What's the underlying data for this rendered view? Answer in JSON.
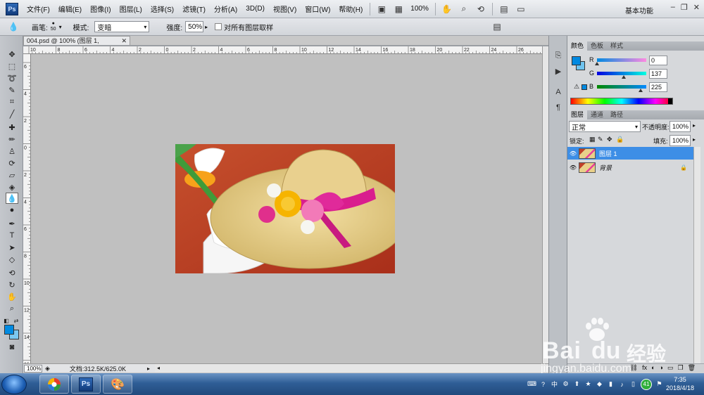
{
  "menubar": {
    "items": [
      "文件(F)",
      "编辑(E)",
      "图像(I)",
      "图层(L)",
      "选择(S)",
      "滤镜(T)",
      "分析(A)",
      "3D(D)",
      "视图(V)",
      "窗口(W)",
      "帮助(H)"
    ],
    "zoom": "100%",
    "workspace": "基本功能"
  },
  "options": {
    "brush_label": "画笔:",
    "brush_size": "50",
    "mode_label": "模式:",
    "mode_value": "变暗",
    "strength_label": "强度:",
    "strength_value": "50%",
    "sample_all_label": "对所有图层取样"
  },
  "document": {
    "tab_title": "004.psd @ 100% (图层 1, RGB/8#)",
    "ruler_h": [
      "10",
      "8",
      "6",
      "4",
      "2",
      "0",
      "2",
      "4",
      "6",
      "8",
      "10",
      "12",
      "14",
      "16",
      "18",
      "20",
      "22",
      "24",
      "26"
    ],
    "ruler_v": [
      "6",
      "4",
      "2",
      "0",
      "2",
      "4",
      "6",
      "8",
      "10",
      "12",
      "14",
      "16"
    ],
    "zoom": "100%",
    "doc_size": "文档:312.5K/625.0K"
  },
  "color_panel": {
    "tabs": [
      "颜色",
      "色板",
      "样式"
    ],
    "r_label": "R",
    "g_label": "G",
    "b_label": "B",
    "r": "0",
    "g": "137",
    "b": "225",
    "r_fraction": 0.0,
    "g_fraction": 0.537,
    "b_fraction": 0.882,
    "foreground": "#0089e1"
  },
  "layers_panel": {
    "tabs": [
      "图层",
      "通道",
      "路径"
    ],
    "blend_mode": "正常",
    "opacity_label": "不透明度:",
    "opacity_value": "100%",
    "lock_label": "锁定:",
    "fill_label": "填充:",
    "fill_value": "100%",
    "layers": [
      {
        "name": "图层 1",
        "selected": true
      },
      {
        "name": "背景",
        "selected": false
      }
    ]
  },
  "taskbar": {
    "badge": "41",
    "time": "7:35",
    "date": "2018/4/18"
  },
  "watermark": {
    "brand": "Bai",
    "brand2": "经验",
    "url": "jingyan.baidu.com"
  }
}
